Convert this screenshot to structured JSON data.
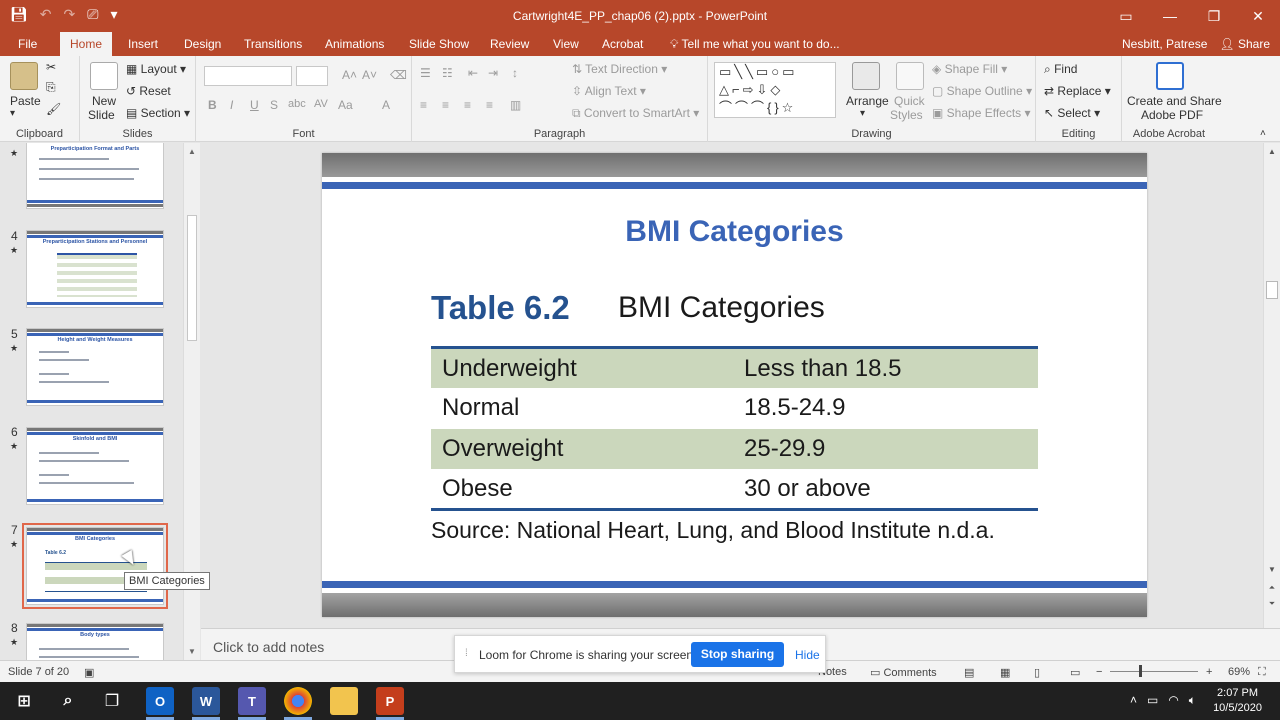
{
  "window": {
    "title": "Cartwright4E_PP_chap06 (2).pptx - PowerPoint"
  },
  "tabs": [
    {
      "label": "File"
    },
    {
      "label": "Home"
    },
    {
      "label": "Insert"
    },
    {
      "label": "Design"
    },
    {
      "label": "Transitions"
    },
    {
      "label": "Animations"
    },
    {
      "label": "Slide Show"
    },
    {
      "label": "Review"
    },
    {
      "label": "View"
    },
    {
      "label": "Acrobat"
    }
  ],
  "tell_me": "Tell me what you want to do...",
  "user": "Nesbitt, Patrese",
  "share": "Share",
  "ribbon": {
    "clipboard": {
      "paste": "Paste",
      "label": "Clipboard"
    },
    "slides": {
      "new_slide": "New",
      "new_slide2": "Slide",
      "layout": "Layout",
      "reset": "Reset",
      "section": "Section",
      "label": "Slides"
    },
    "font": {
      "label": "Font"
    },
    "paragraph": {
      "text_direction": "Text Direction",
      "align_text": "Align Text",
      "convert_smartart": "Convert to SmartArt",
      "label": "Paragraph"
    },
    "drawing": {
      "arrange": "Arrange",
      "quick": "Quick",
      "styles": "Styles",
      "shape_fill": "Shape Fill",
      "shape_outline": "Shape Outline",
      "shape_effects": "Shape Effects",
      "label": "Drawing"
    },
    "editing": {
      "find": "Find",
      "replace": "Replace",
      "select": "Select",
      "label": "Editing"
    },
    "acrobat": {
      "create_share": "Create and Share",
      "adobe_pdf": "Adobe PDF",
      "label": "Adobe Acrobat"
    }
  },
  "thumbnails": [
    {
      "num": "",
      "title": "Preparticipation Format and Parts"
    },
    {
      "num": "4",
      "title": "Preparticipation Stations and Personnel"
    },
    {
      "num": "5",
      "title": "Height and Weight Measures"
    },
    {
      "num": "6",
      "title": "Skinfold and BMI"
    },
    {
      "num": "7",
      "title": "BMI Categories"
    },
    {
      "num": "8",
      "title": "Body types"
    }
  ],
  "slide": {
    "title": "BMI Categories",
    "table_number": "Table 6.2",
    "table_name": "BMI Categories",
    "rows": [
      {
        "category": "Underweight",
        "range": "Less than 18.5"
      },
      {
        "category": "Normal",
        "range": "18.5-24.9"
      },
      {
        "category": "Overweight",
        "range": "25-29.9"
      },
      {
        "category": "Obese",
        "range": "30 or above"
      }
    ],
    "source": "Source: National Heart, Lung, and Blood Institute n.d.a."
  },
  "tooltip": "BMI Categories",
  "notes_placeholder": "Click to add notes",
  "status": {
    "slide_count": "Slide 7 of 20",
    "notes": "Notes",
    "comments": "Comments",
    "zoom": "69%"
  },
  "loom": {
    "message": "Loom for Chrome is sharing your screen.",
    "stop": "Stop sharing",
    "hide": "Hide"
  },
  "taskbar": {
    "time": "2:07 PM",
    "date": "10/5/2020"
  },
  "colors": {
    "brand": "#b7472a",
    "slide_blue": "#3a64b6",
    "table_shade": "#cbd7bc"
  }
}
